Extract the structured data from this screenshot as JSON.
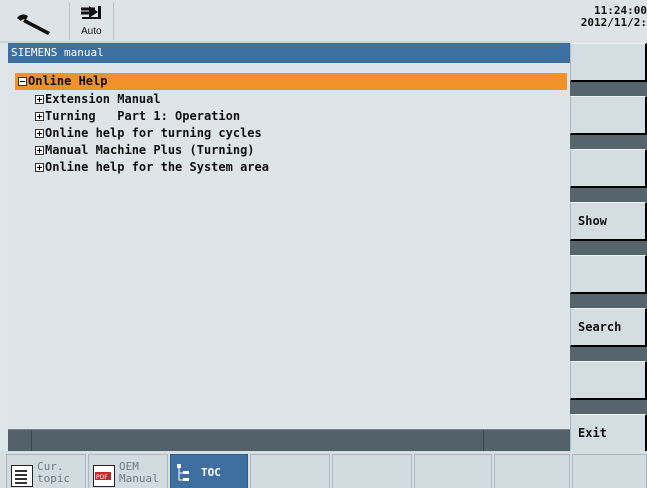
{
  "header": {
    "tool_icon": "wrench-icon",
    "mode_icon": "arrow-right-to-bar-icon",
    "mode_label": "Auto",
    "time": "11:24:00",
    "date": "2012/11/2:"
  },
  "window": {
    "title": "SIEMENS manual"
  },
  "tree": {
    "root": {
      "label": "Online Help",
      "expanded": true
    },
    "items": [
      {
        "label": "Extension Manual"
      },
      {
        "label": "Turning   Part 1: Operation"
      },
      {
        "label": "Online help for turning cycles"
      },
      {
        "label": "Manual Machine Plus (Turning)"
      },
      {
        "label": "Online help for the System area"
      }
    ]
  },
  "vertical_softkeys": [
    "",
    "",
    "",
    "Show",
    "",
    "Search",
    "",
    "Exit"
  ],
  "horizontal_softkeys": [
    {
      "line1": "Cur.",
      "line2": "topic",
      "icon": "document-icon"
    },
    {
      "line1": "OEM",
      "line2": "Manual",
      "icon": "pdf-icon"
    },
    {
      "line1": "TOC",
      "line2": "",
      "icon": "toc-tree-icon",
      "active": true
    },
    {
      "line1": "",
      "line2": ""
    },
    {
      "line1": "",
      "line2": ""
    },
    {
      "line1": "",
      "line2": ""
    },
    {
      "line1": "",
      "line2": ""
    },
    {
      "line1": "",
      "line2": ""
    }
  ],
  "colors": {
    "title_bar": "#3d6fa0",
    "selection": "#f0912a",
    "background": "#dde5e8",
    "softkey": "#d4dde2",
    "softkey_gap": "#56646b"
  }
}
